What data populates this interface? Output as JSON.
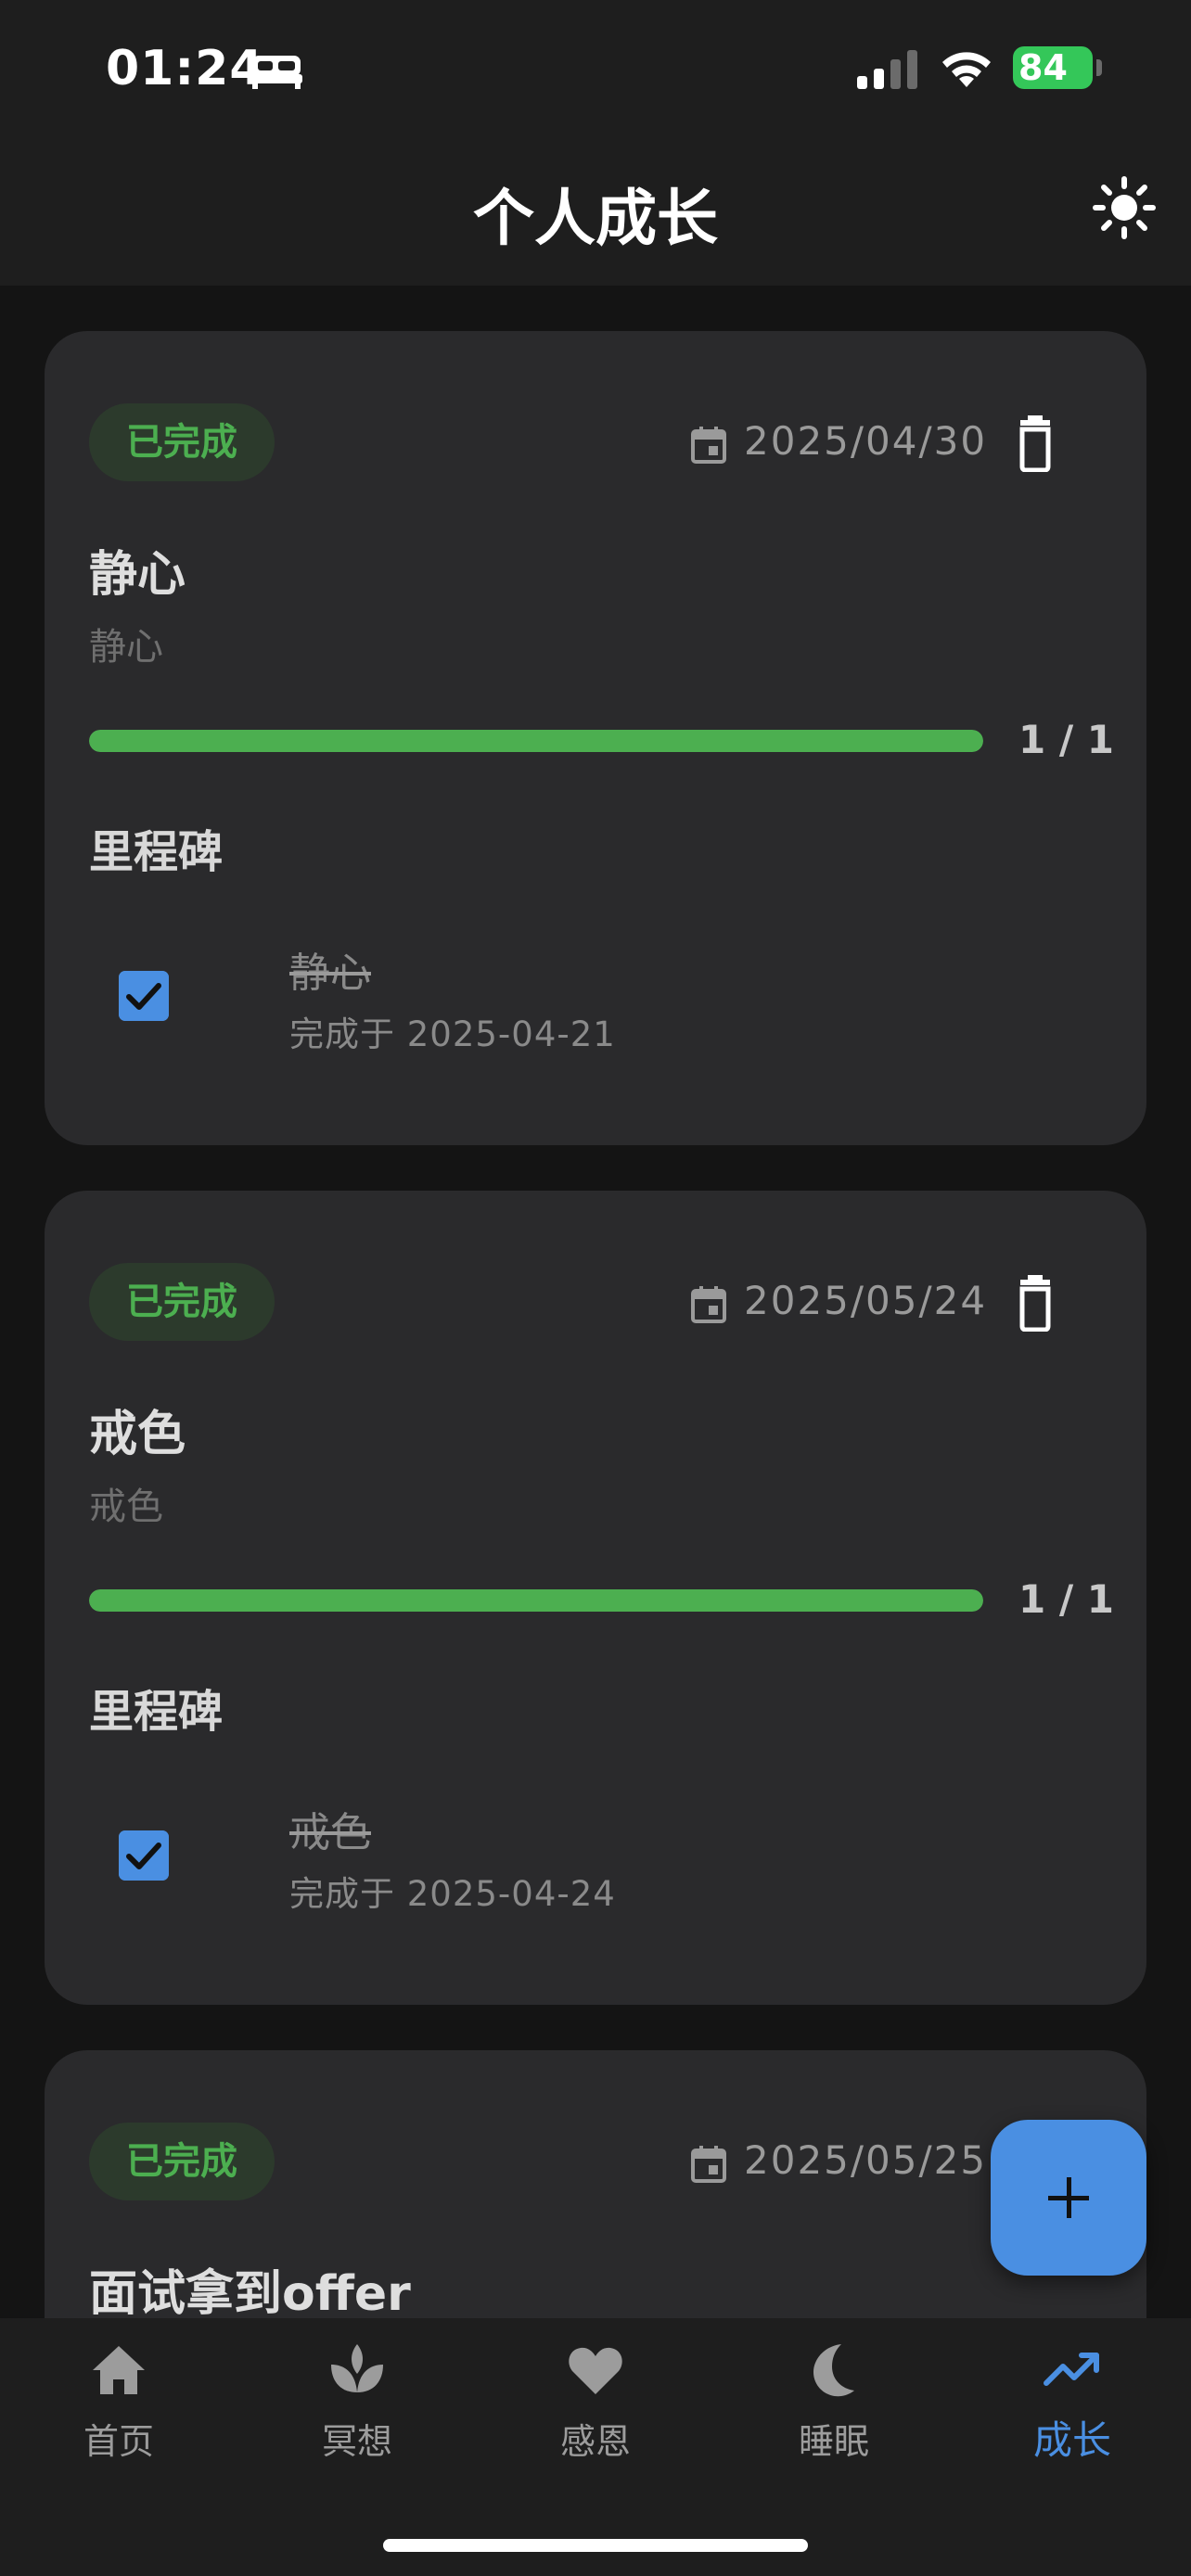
{
  "status_bar": {
    "time": "01:24",
    "battery": "84"
  },
  "header": {
    "title": "个人成长"
  },
  "goals": [
    {
      "status": "已完成",
      "date": "2025/04/30",
      "title": "静心",
      "description": "静心",
      "progress": 1.0,
      "progress_text": "1 / 1",
      "milestones_heading": "里程碑",
      "milestone": {
        "name": "静心",
        "completed_text": "完成于 2025-04-21",
        "checked": true
      }
    },
    {
      "status": "已完成",
      "date": "2025/05/24",
      "title": "戒色",
      "description": "戒色",
      "progress": 1.0,
      "progress_text": "1 / 1",
      "milestones_heading": "里程碑",
      "milestone": {
        "name": "戒色",
        "completed_text": "完成于 2025-04-24",
        "checked": true
      }
    },
    {
      "status": "已完成",
      "date": "2025/05/25",
      "title": "面试拿到offer"
    }
  ],
  "bottom_nav": [
    {
      "label": "首页",
      "icon": "home-icon"
    },
    {
      "label": "冥想",
      "icon": "lotus-icon"
    },
    {
      "label": "感恩",
      "icon": "heart-icon"
    },
    {
      "label": "睡眠",
      "icon": "moon-icon"
    },
    {
      "label": "成长",
      "icon": "trending-up-icon",
      "active": true
    }
  ],
  "colors": {
    "accent": "#4a8fe2",
    "success": "#4caf50",
    "card": "#2a2a2c",
    "background": "#141414"
  }
}
